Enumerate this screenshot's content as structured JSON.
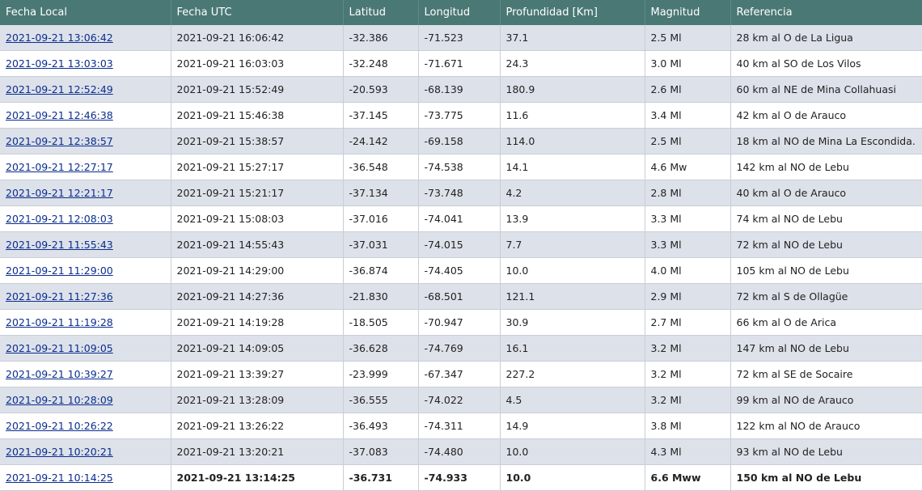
{
  "headers": [
    "Fecha Local",
    "Fecha UTC",
    "Latitud",
    "Longitud",
    "Profundidad [Km]",
    "Magnitud",
    "Referencia"
  ],
  "rows": [
    {
      "local": "2021-09-21 13:06:42",
      "utc": "2021-09-21 16:06:42",
      "lat": "-32.386",
      "lon": "-71.523",
      "depth": "37.1",
      "mag": "2.5 Ml",
      "ref": "28 km al O de La Ligua"
    },
    {
      "local": "2021-09-21 13:03:03",
      "utc": "2021-09-21 16:03:03",
      "lat": "-32.248",
      "lon": "-71.671",
      "depth": "24.3",
      "mag": "3.0 Ml",
      "ref": "40 km al SO de Los Vilos"
    },
    {
      "local": "2021-09-21 12:52:49",
      "utc": "2021-09-21 15:52:49",
      "lat": "-20.593",
      "lon": "-68.139",
      "depth": "180.9",
      "mag": "2.6 Ml",
      "ref": "60 km al NE de Mina Collahuasi"
    },
    {
      "local": "2021-09-21 12:46:38",
      "utc": "2021-09-21 15:46:38",
      "lat": "-37.145",
      "lon": "-73.775",
      "depth": "11.6",
      "mag": "3.4 Ml",
      "ref": "42 km al O de Arauco"
    },
    {
      "local": "2021-09-21 12:38:57",
      "utc": "2021-09-21 15:38:57",
      "lat": "-24.142",
      "lon": "-69.158",
      "depth": "114.0",
      "mag": "2.5 Ml",
      "ref": "18 km al NO de Mina La Escondida."
    },
    {
      "local": "2021-09-21 12:27:17",
      "utc": "2021-09-21 15:27:17",
      "lat": "-36.548",
      "lon": "-74.538",
      "depth": "14.1",
      "mag": "4.6 Mw",
      "ref": "142 km al NO de Lebu"
    },
    {
      "local": "2021-09-21 12:21:17",
      "utc": "2021-09-21 15:21:17",
      "lat": "-37.134",
      "lon": "-73.748",
      "depth": "4.2",
      "mag": "2.8 Ml",
      "ref": "40 km al O de Arauco"
    },
    {
      "local": "2021-09-21 12:08:03",
      "utc": "2021-09-21 15:08:03",
      "lat": "-37.016",
      "lon": "-74.041",
      "depth": "13.9",
      "mag": "3.3 Ml",
      "ref": "74 km al NO de Lebu"
    },
    {
      "local": "2021-09-21 11:55:43",
      "utc": "2021-09-21 14:55:43",
      "lat": "-37.031",
      "lon": "-74.015",
      "depth": "7.7",
      "mag": "3.3 Ml",
      "ref": "72 km al NO de Lebu"
    },
    {
      "local": "2021-09-21 11:29:00",
      "utc": "2021-09-21 14:29:00",
      "lat": "-36.874",
      "lon": "-74.405",
      "depth": "10.0",
      "mag": "4.0 Ml",
      "ref": "105 km al NO de Lebu"
    },
    {
      "local": "2021-09-21 11:27:36",
      "utc": "2021-09-21 14:27:36",
      "lat": "-21.830",
      "lon": "-68.501",
      "depth": "121.1",
      "mag": "2.9 Ml",
      "ref": "72 km al S de Ollagüe"
    },
    {
      "local": "2021-09-21 11:19:28",
      "utc": "2021-09-21 14:19:28",
      "lat": "-18.505",
      "lon": "-70.947",
      "depth": "30.9",
      "mag": "2.7 Ml",
      "ref": "66 km al O de Arica"
    },
    {
      "local": "2021-09-21 11:09:05",
      "utc": "2021-09-21 14:09:05",
      "lat": "-36.628",
      "lon": "-74.769",
      "depth": "16.1",
      "mag": "3.2 Ml",
      "ref": "147 km al NO de Lebu"
    },
    {
      "local": "2021-09-21 10:39:27",
      "utc": "2021-09-21 13:39:27",
      "lat": "-23.999",
      "lon": "-67.347",
      "depth": "227.2",
      "mag": "3.2 Ml",
      "ref": "72 km al SE de Socaire"
    },
    {
      "local": "2021-09-21 10:28:09",
      "utc": "2021-09-21 13:28:09",
      "lat": "-36.555",
      "lon": "-74.022",
      "depth": "4.5",
      "mag": "3.2 Ml",
      "ref": "99 km al NO de Arauco"
    },
    {
      "local": "2021-09-21 10:26:22",
      "utc": "2021-09-21 13:26:22",
      "lat": "-36.493",
      "lon": "-74.311",
      "depth": "14.9",
      "mag": "3.8 Ml",
      "ref": "122 km al NO de Arauco"
    },
    {
      "local": "2021-09-21 10:20:21",
      "utc": "2021-09-21 13:20:21",
      "lat": "-37.083",
      "lon": "-74.480",
      "depth": "10.0",
      "mag": "4.3 Ml",
      "ref": "93 km al NO de Lebu"
    },
    {
      "local": "2021-09-21 10:14:25",
      "utc": "2021-09-21 13:14:25",
      "lat": "-36.731",
      "lon": "-74.933",
      "depth": "10.0",
      "mag": "6.6 Mww",
      "ref": "150 km al NO de Lebu",
      "bold": true
    }
  ]
}
